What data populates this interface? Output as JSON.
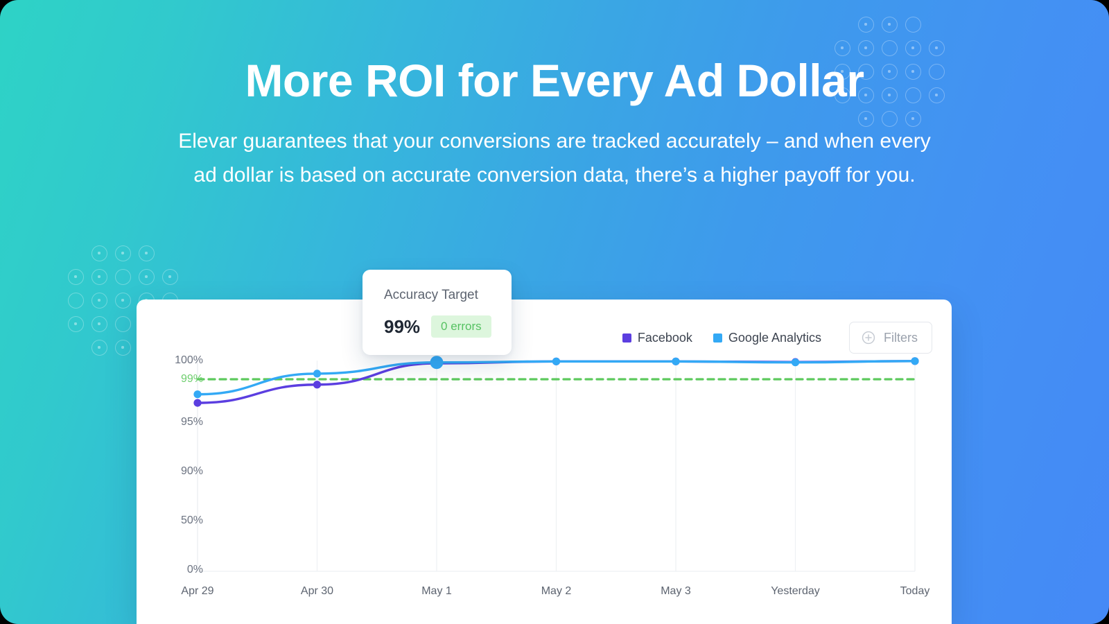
{
  "hero": {
    "title": "More ROI for Every Ad Dollar",
    "subtitle": "Elevar guarantees that your conversions are tracked accurately – and when every ad dollar is based on accurate conversion data, there’s a higher payoff for you."
  },
  "tooltip": {
    "title": "Accuracy Target",
    "value": "99%",
    "badge": "0 errors"
  },
  "toolbar": {
    "filters_label": "Filters",
    "plus_icon": "plus-circle-icon"
  },
  "colors": {
    "facebook": "#5b3ee0",
    "google_analytics": "#33a9f5",
    "target_line": "#5dc95d",
    "badge_text": "#56c262",
    "badge_bg": "#ddf6dd",
    "gradient_start": "#2ed3c6",
    "gradient_end": "#4589f6"
  },
  "chart_data": {
    "type": "line",
    "title": "",
    "xlabel": "",
    "ylabel": "",
    "grid": true,
    "legend_position": "top-right",
    "x": [
      "Apr 29",
      "Apr 30",
      "May 1",
      "May 2",
      "May 3",
      "Yesterday",
      "Today"
    ],
    "ytick_labels": [
      "100%",
      "99%",
      "95%",
      "90%",
      "50%",
      "0%"
    ],
    "ytick_values": [
      100,
      99,
      95,
      90,
      50,
      0
    ],
    "ylim": [
      0,
      100
    ],
    "reference_line": {
      "label": "99%",
      "value": 99,
      "style": "dashed",
      "color": "#5dc95d"
    },
    "series": [
      {
        "name": "Facebook",
        "color": "#5b3ee0",
        "values": [
          96.8,
          98.5,
          99.85,
          99.95,
          99.95,
          99.92,
          99.97
        ]
      },
      {
        "name": "Google Analytics",
        "color": "#33a9f5",
        "values": [
          97.6,
          99.3,
          99.9,
          99.95,
          99.95,
          99.9,
          99.97
        ]
      }
    ]
  }
}
